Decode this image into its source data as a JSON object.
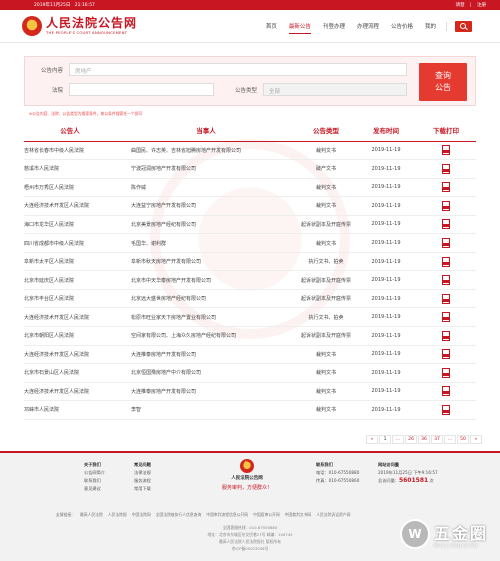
{
  "topbar": {
    "date": "2019年11月25日",
    "time": "21:16:57",
    "login": "请登",
    "register": "注册"
  },
  "logo": {
    "cn": "人民法院公告网",
    "en": "THE PEOPLE'S COURT ANNOUNCEMENT"
  },
  "nav": [
    "首页",
    "最新公告",
    "刊登办理",
    "办理流程",
    "公告价格",
    "我的"
  ],
  "search": {
    "content_label": "公告内容",
    "content_value": "房地产",
    "court_label": "法院",
    "court_value": "",
    "type_label": "公告类型",
    "type_value": "全部",
    "query_label_1": "查询",
    "query_label_2": "公告"
  },
  "hint": "※公告内容、法院、公告类型为搜索条件，按以条件搜索任一个即可",
  "table": {
    "headers": [
      "公告人",
      "当事人",
      "公告类型",
      "发布时间",
      "下载打印"
    ],
    "rows": [
      [
        "吉林省长春市中级人民法院",
        "曲国民、许志英、吉林省旭腾房地产开发有限公司",
        "裁判文书",
        "2019-11-19"
      ],
      [
        "慈溪市人民法院",
        "宁波冠润房地产开发有限公司",
        "破产文书",
        "2019-11-19"
      ],
      [
        "梧州市万秀区人民法院",
        "陈作威",
        "裁判文书",
        "2019-11-19"
      ],
      [
        "大连经济技术开发区人民法院",
        "大连益宁房地产开发有限公司",
        "裁判文书",
        "2019-11-19"
      ],
      [
        "海口市龙华区人民法院",
        "北京美景房地产经纪有限公司",
        "起诉状副本及开庭传票",
        "2019-11-19"
      ],
      [
        "四川省成都市中级人民法院",
        "毛国华、谢利群",
        "裁判文书",
        "2019-11-19"
      ],
      [
        "阜新市太平区人民法院",
        "阜新市秋天房地产开发有限公司",
        "执行文书、拍卖",
        "2019-11-19"
      ],
      [
        "北京市延庆区人民法院",
        "北京市中天华泰房地产开发有限公司",
        "起诉状副本及开庭传票",
        "2019-11-19"
      ],
      [
        "北京市丰台区人民法院",
        "北京远大盛世房地产经纪有限公司",
        "起诉状副本及开庭传票",
        "2019-11-19"
      ],
      [
        "大连经济技术开发区人民法院",
        "松原市旺业家天下房地产置业有限公司",
        "执行文书、拍卖",
        "2019-11-19"
      ],
      [
        "北京市朝阳区人民法院",
        "空间家有限公司、上海众久房地产经纪有限公司",
        "起诉状副本及开庭传票",
        "2019-11-19"
      ],
      [
        "大连经济技术开发区人民法院",
        "大连推泰房地产开发有限公司",
        "裁判文书",
        "2019-11-19"
      ],
      [
        "北京市石景山区人民法院",
        "北京恒国豫房地产中介有限公司",
        "裁判文书",
        "2019-11-19"
      ],
      [
        "大连经济技术开发区人民法院",
        "大连推泰房地产开发有限公司",
        "裁判文书",
        "2019-11-19"
      ],
      [
        "邛崃市人民法院",
        "李智",
        "裁判文书",
        "2019-11-19"
      ]
    ]
  },
  "pagination": [
    "«",
    "1",
    "...",
    "26",
    "36",
    "37",
    "...",
    "50",
    "»"
  ],
  "footer": {
    "about_title": "关于我们",
    "about_items": [
      "公告网简介",
      "联系我们",
      "意见建议"
    ],
    "faq_title": "常见问题",
    "faq_items": [
      "法律法规",
      "服务流程",
      "常用下载"
    ],
    "center_name": "人民法院公告网",
    "slogan": "服务审判，方便群众！",
    "contact_title": "联系我们",
    "contact_items": [
      "电话：010-67550880",
      "传真：010-67550860"
    ],
    "stats_title": "网站访问量",
    "stats_time": "2019年11月25日 下午9:16:57",
    "visits_label": "总访问量：",
    "visits_value": "5601581",
    "visits_unit": "次",
    "links": [
      "友情链接：",
      "最高人民法院",
      "人民法院报",
      "中国法院网",
      "全国法院被执行人信息查询",
      "中国审判流程信息公开网",
      "中国庭审公开网",
      "中国裁判文书网",
      "人民法院诉讼资产网"
    ],
    "info": [
      "全国客服热线：010-67550880",
      "地址：北京市东城区东交民巷27号 邮编：100745",
      "最高人民法院人民法院报社 版权所有",
      "京ICP备05023036号"
    ]
  },
  "watermark": {
    "cn": "五金圈",
    "en": "WUJINQUAN"
  }
}
